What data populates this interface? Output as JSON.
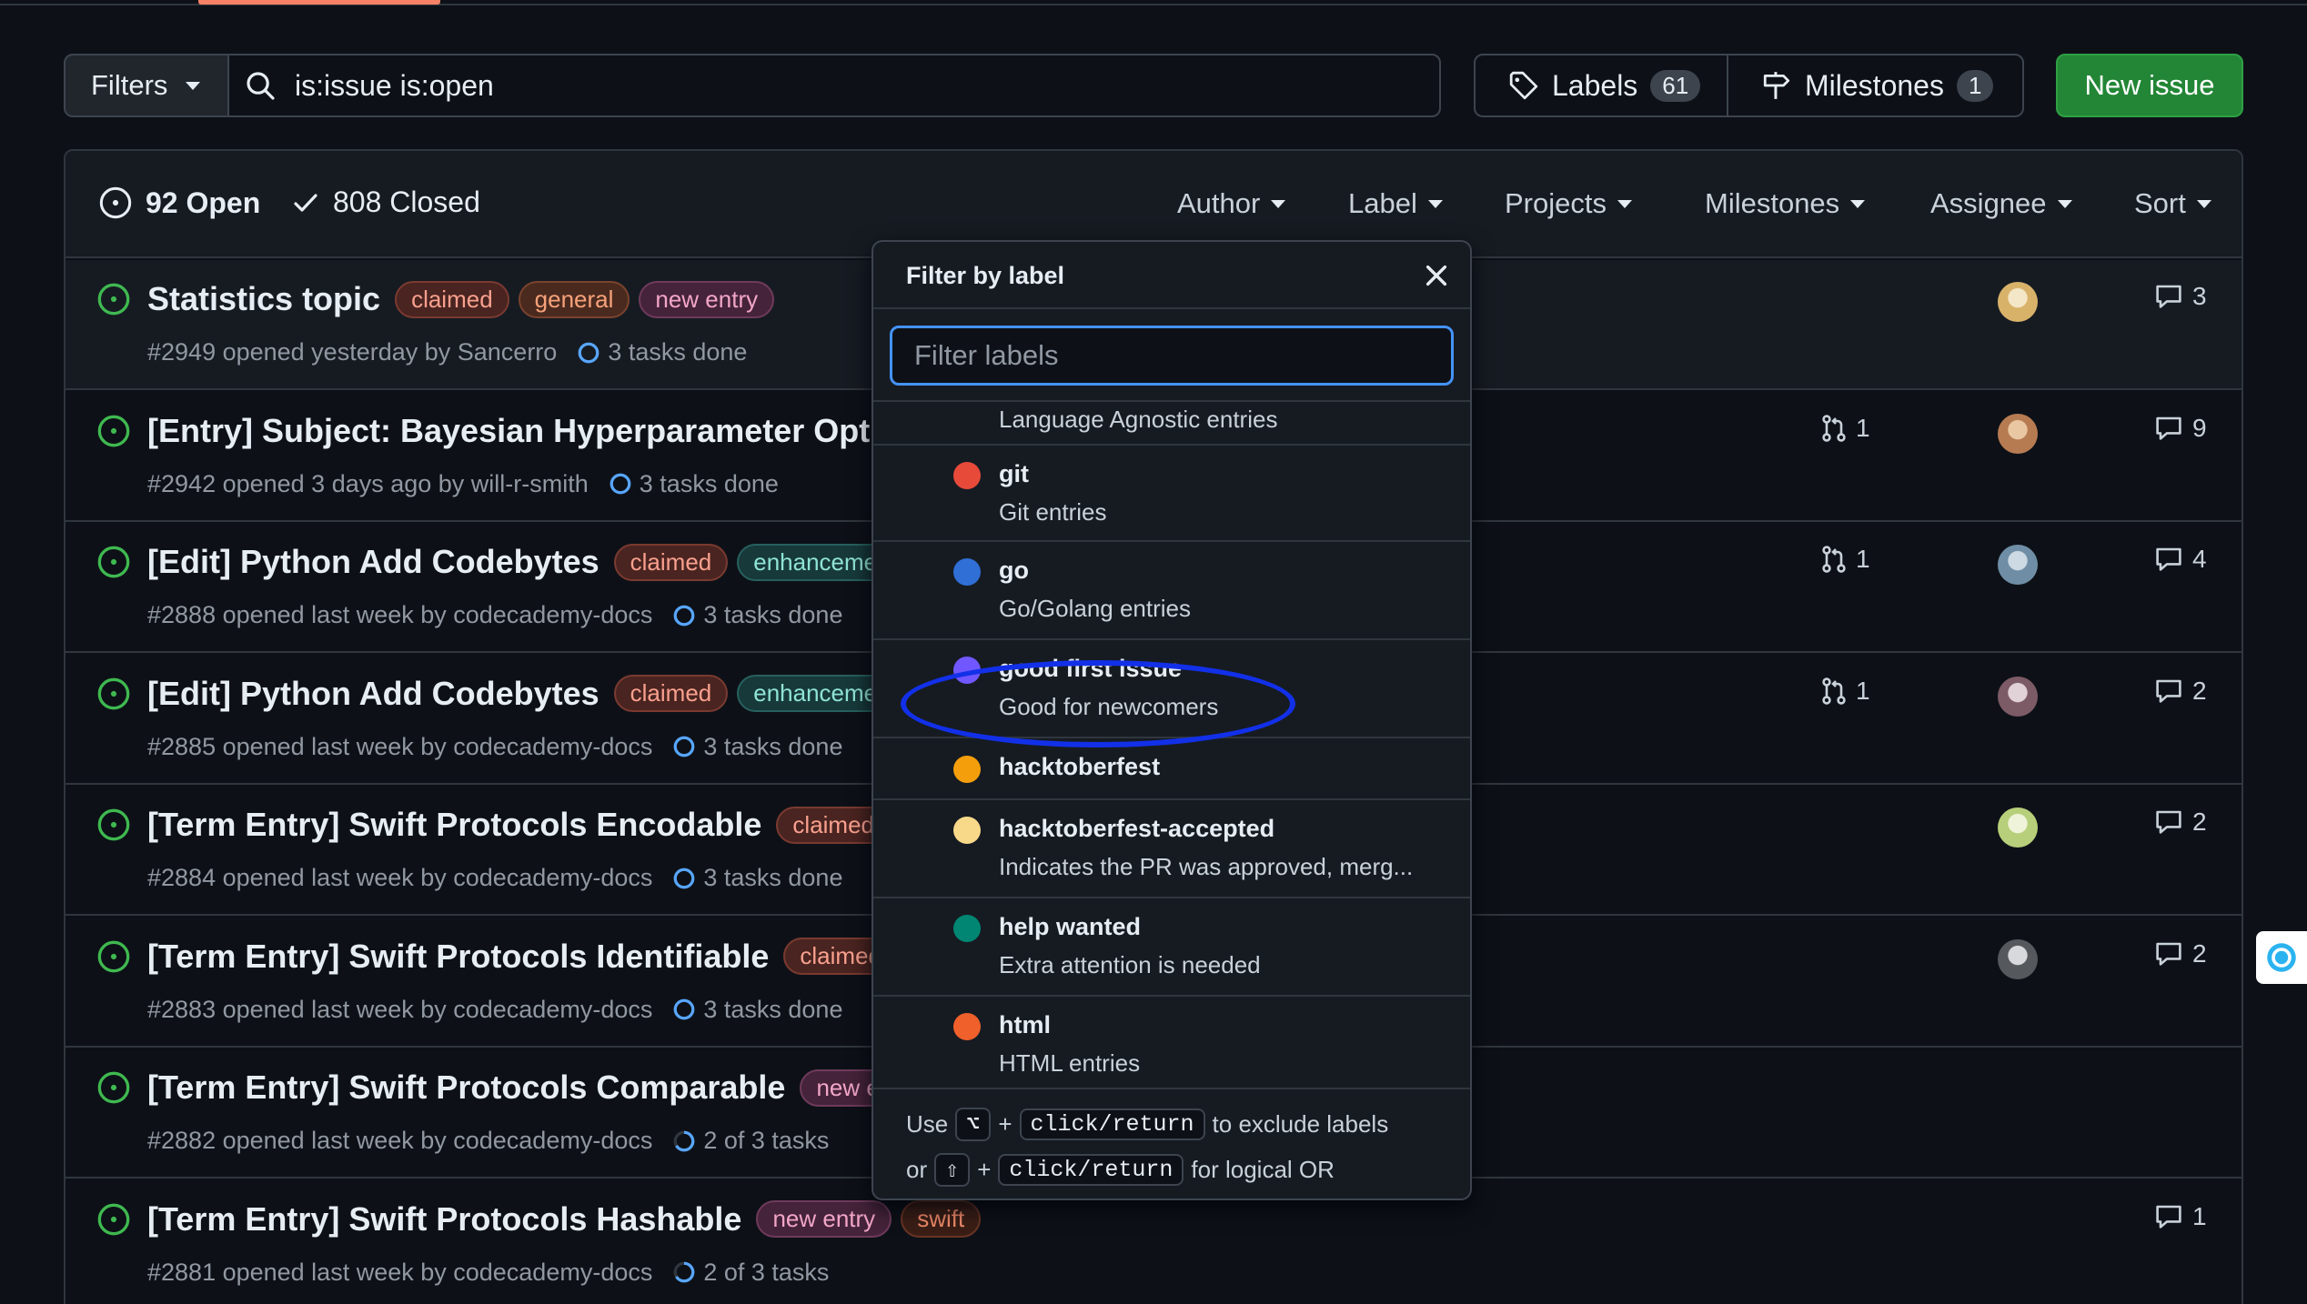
{
  "subnav": {
    "filters_label": "Filters",
    "search_value": "is:issue is:open",
    "labels_label": "Labels",
    "labels_count": "61",
    "milestones_label": "Milestones",
    "milestones_count": "1",
    "new_issue_label": "New issue"
  },
  "header": {
    "open": "92 Open",
    "closed": "808 Closed",
    "filters": [
      "Author",
      "Label",
      "Projects",
      "Milestones",
      "Assignee",
      "Sort"
    ]
  },
  "issues": [
    {
      "title": "Statistics topic",
      "labels": [
        "claimed",
        "general",
        "new entry"
      ],
      "meta": "#2949 opened yesterday by Sancerro",
      "tasks": "3 tasks done",
      "pr": "",
      "comments": "3"
    },
    {
      "title": "[Entry] Subject: Bayesian Hyperparameter Optin",
      "labels": [],
      "meta": "#2942 opened 3 days ago by will-r-smith",
      "tasks": "3 tasks done",
      "pr": "1",
      "comments": "9"
    },
    {
      "title": "[Edit] Python Add Codebytes",
      "labels": [
        "claimed",
        "enhanceme"
      ],
      "meta": "#2888 opened last week by codecademy-docs",
      "tasks": "3 tasks done",
      "pr": "1",
      "comments": "4"
    },
    {
      "title": "[Edit] Python Add Codebytes",
      "labels": [
        "claimed",
        "enhanceme"
      ],
      "meta": "#2885 opened last week by codecademy-docs",
      "tasks": "3 tasks done",
      "pr": "1",
      "comments": "2"
    },
    {
      "title": "[Term Entry] Swift Protocols Encodable",
      "labels": [
        "claimed"
      ],
      "meta": "#2884 opened last week by codecademy-docs",
      "tasks": "3 tasks done",
      "pr": "",
      "comments": "2"
    },
    {
      "title": "[Term Entry] Swift Protocols Identifiable",
      "labels": [
        "claimed"
      ],
      "meta": "#2883 opened last week by codecademy-docs",
      "tasks": "3 tasks done",
      "pr": "",
      "comments": "2"
    },
    {
      "title": "[Term Entry] Swift Protocols Comparable",
      "labels": [
        "new en"
      ],
      "meta": "#2882 opened last week by codecademy-docs",
      "tasks": "2 of 3 tasks",
      "pr": "",
      "comments": ""
    },
    {
      "title": "[Term Entry] Swift Protocols Hashable",
      "labels": [
        "new entry",
        "swift"
      ],
      "meta": "#2881 opened last week by codecademy-docs",
      "tasks": "2 of 3 tasks",
      "pr": "",
      "comments": "1"
    }
  ],
  "dropdown": {
    "title": "Filter by label",
    "filter_placeholder": "Filter labels",
    "partial_desc": "Language Agnostic entries",
    "items": [
      {
        "name": "git",
        "desc": "Git entries",
        "color": "#e84a3a"
      },
      {
        "name": "go",
        "desc": "Go/Golang entries",
        "color": "#2f6fd6"
      },
      {
        "name": "good first issue",
        "desc": "Good for newcomers",
        "color": "#7057ff"
      },
      {
        "name": "hacktoberfest",
        "desc": "",
        "color": "#f59e0b"
      },
      {
        "name": "hacktoberfest-accepted",
        "desc": "Indicates the PR was approved, merg...",
        "color": "#f8d98a"
      },
      {
        "name": "help wanted",
        "desc": "Extra attention is needed",
        "color": "#008672"
      },
      {
        "name": "html",
        "desc": "HTML entries",
        "color": "#f0602a"
      }
    ],
    "footer": {
      "use": "Use",
      "key_alt": "⌥",
      "plus": "+",
      "key_click": "click/return",
      "exclude": "to exclude labels",
      "or": "or",
      "key_shift": "⇧",
      "logical_or": "for logical OR"
    }
  }
}
